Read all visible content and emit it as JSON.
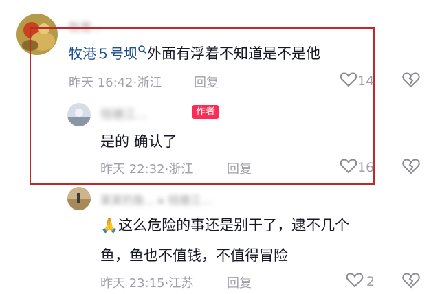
{
  "highlight_color": "#c0282d",
  "comments": [
    {
      "username_blurred": "牧港…",
      "name": "牧港５号坝",
      "text": "外面有浮着不知道是不是他",
      "time": "昨天 16:42",
      "location": "浙江",
      "reply_label": "回复",
      "likes": "14",
      "replies": [
        {
          "username_blurred": "钱塘江…",
          "author_badge": "作者",
          "text": "是的 确认了",
          "time": "昨天 22:32",
          "location": "浙江",
          "reply_label": "回复",
          "likes": "16"
        },
        {
          "username_blurred": "某某钓鱼… ▸ 钱塘江…",
          "emoji": "🙏",
          "text_line1": "这么危险的事还是别干了，逮不几个",
          "text_line2": "鱼，鱼也不值钱，不值得冒险",
          "time": "昨天 23:15",
          "location": "江苏",
          "reply_label": "回复",
          "likes": "2"
        }
      ]
    }
  ],
  "icons": {
    "like": "heart-outline-icon",
    "dislike": "broken-heart-icon",
    "search": "search-icon"
  }
}
